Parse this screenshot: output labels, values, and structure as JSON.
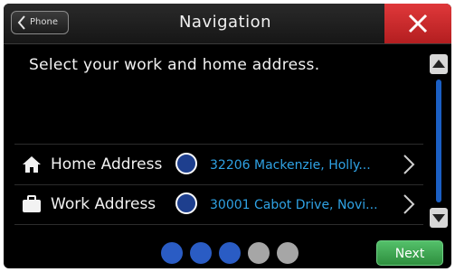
{
  "header": {
    "back_label": "Phone",
    "title": "Navigation"
  },
  "content": {
    "prompt": "Select your work and home address."
  },
  "rows": [
    {
      "label": "Home Address",
      "value": "32206 Mackenzie, Holly...",
      "icon": "home-icon"
    },
    {
      "label": "Work Address",
      "value": "30001 Cabot Drive, Novi...",
      "icon": "briefcase-icon"
    }
  ],
  "pager": {
    "total_pages": 5,
    "active_pages": 3
  },
  "footer": {
    "next_label": "Next"
  },
  "colors": {
    "close_red": "#d42a2c",
    "value_blue": "#2fa2e4",
    "marker_blue": "#1e3f8e",
    "next_green": "#3fa853",
    "scroll_blue": "#1b5fc4"
  }
}
